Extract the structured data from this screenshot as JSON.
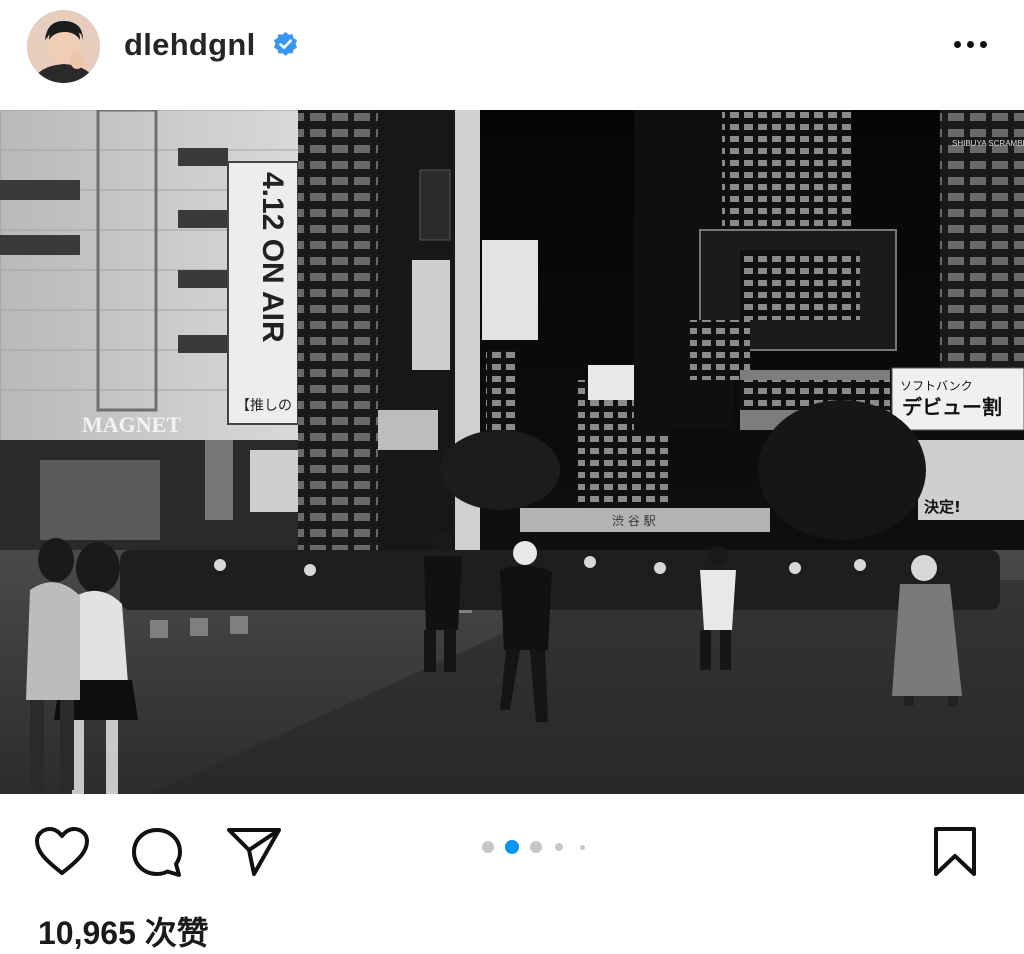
{
  "post": {
    "username": "dlehdgnl",
    "verified": true,
    "likes_text": "10,965 次赞"
  },
  "header": {
    "avatar_icon": "profile-avatar",
    "verified_icon": "verified-badge-icon",
    "more_icon": "more-options-icon"
  },
  "photo": {
    "description_tag": "street-photo",
    "signs": {
      "magnet": "MAGNET",
      "onair": "4.12 ON AIR",
      "oshino": "【推しの",
      "softbank": "ソフトバンク",
      "debut": "デビュー割",
      "station": "渋 谷 駅",
      "shibuya_sky": "SHIBUYA SCRAMBLE SQUARE",
      "kettei": "決定!"
    }
  },
  "actions": {
    "like_icon": "heart-icon",
    "comment_icon": "comment-icon",
    "share_icon": "send-icon",
    "save_icon": "bookmark-icon"
  },
  "carousel": {
    "total": 5,
    "active_index": 1
  },
  "colors": {
    "verified_blue": "#3897f0",
    "active_dot": "#0095f6",
    "inactive_dot": "#c7c7c7"
  }
}
